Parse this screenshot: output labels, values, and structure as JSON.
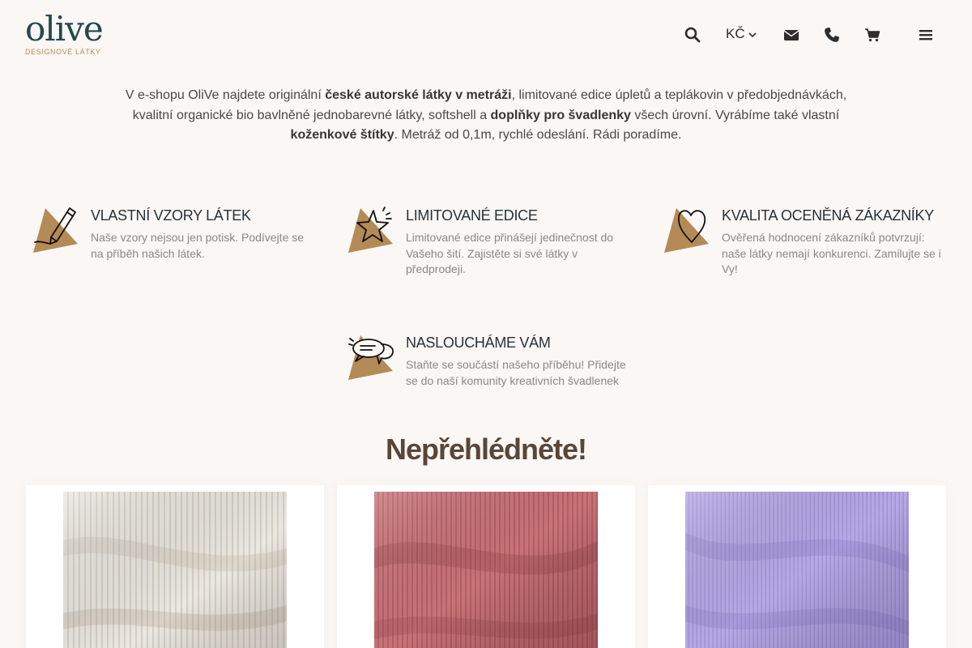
{
  "header": {
    "logo_word": "olive",
    "logo_sub": "DESIGNOVÉ LÁTKY",
    "currency": "KČ",
    "icons": [
      "search-icon",
      "chevron-down-icon",
      "envelope-icon",
      "phone-icon",
      "cart-icon",
      "menu-icon"
    ]
  },
  "intro": {
    "p1": "V e-shopu OliVe najdete originální ",
    "b1": "české autorské látky v metráži",
    "p2": ", limitované edice úpletů a teplákovin v předobjednávkách, kvalitní organické bio bavlněné jednobarevné látky, softshell a ",
    "b2": "doplňky pro švadlenky",
    "p3": " všech úrovní. Vyrábíme také vlastní ",
    "b3": "koženkové štítky",
    "p4": ". Metráž od 0,1m, rychlé odeslání. Rádi poradíme."
  },
  "features": [
    {
      "title": "VLASTNÍ VZORY LÁTEK",
      "text": "Naše vzory nejsou jen potisk. Podívejte se na příběh našich látek.",
      "icon": "pencil-icon"
    },
    {
      "title": "LIMITOVANÉ EDICE",
      "text": "Limitované edice přinášejí jedinečnost do Vašeho šití. Zajistěte si své látky v předprodeji.",
      "icon": "star-icon"
    },
    {
      "title": "KVALITA OCENĚNÁ ZÁKAZNÍKY",
      "text": "Ověřená hodnocení zákazníků potvrzují: naše látky nemají konkurenci. Zamilujte se i Vy!",
      "icon": "heart-icon"
    },
    {
      "title": "NASLOUCHÁME VÁM",
      "text": "Staňte se součástí našeho příběhu! Přidejte se do naší komunity kreativních švadlenek",
      "icon": "speech-bubbles-icon"
    }
  ],
  "section": {
    "title": "Nepřehlédněte!"
  },
  "colors": {
    "accent": "#b48b56",
    "brand": "#234850",
    "background": "#faf7f5",
    "card_1": "#ebe7e1",
    "card_2": "#c97378",
    "card_3": "#b7a9e6"
  }
}
